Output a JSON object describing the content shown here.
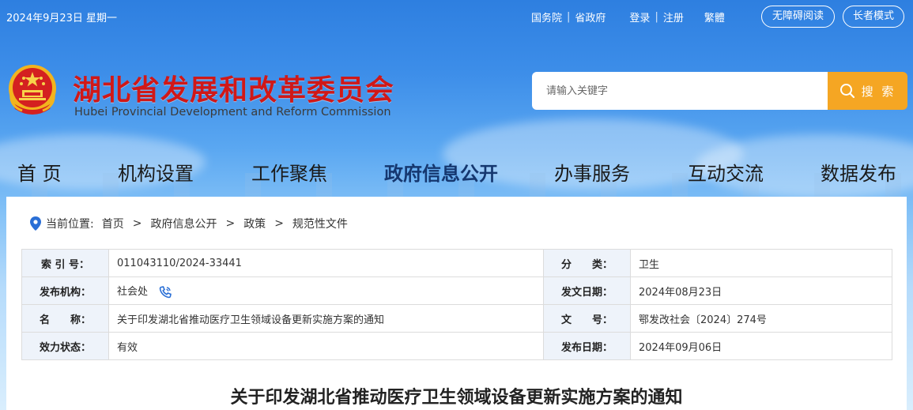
{
  "topbar": {
    "date": "2024年9月23日 星期一",
    "link_state_council": "国务院",
    "link_province": "省政府",
    "login": "登录",
    "register": "注册",
    "traditional": "繁體",
    "accessible": "无障碍阅读",
    "elder_mode": "长者模式"
  },
  "brand": {
    "title_cn": "湖北省发展和改革委员会",
    "title_en": "Hubei Provincial Development and Reform Commission"
  },
  "search": {
    "placeholder": "请输入关键字",
    "button_label": "搜 索"
  },
  "nav": {
    "items": [
      "首 页",
      "机构设置",
      "工作聚焦",
      "政府信息公开",
      "办事服务",
      "互动交流",
      "数据发布"
    ],
    "active": "政府信息公开"
  },
  "breadcrumb": {
    "prefix": "当前位置:",
    "items": [
      "首页",
      "政府信息公开",
      "政策",
      "规范性文件"
    ]
  },
  "info": {
    "index_label": "索 引 号：",
    "index_value": "011043110/2024-33441",
    "category_label": "分　　类：",
    "category_value": "卫生",
    "publisher_label": "发布机构：",
    "publisher_value": "社会处",
    "issue_date_label": "发文日期：",
    "issue_date_value": "2024年08月23日",
    "name_label": "名　　称：",
    "name_value": "关于印发湖北省推动医疗卫生领域设备更新实施方案的通知",
    "doc_no_label": "文　　号：",
    "doc_no_value": "鄂发改社会〔2024〕274号",
    "status_label": "效力状态：",
    "status_value": "有效",
    "publish_date_label": "发布日期：",
    "publish_date_value": "2024年09月06日"
  },
  "document": {
    "title": "关于印发湖北省推动医疗卫生领域设备更新实施方案的通知"
  },
  "colors": {
    "brand_red": "#d01818",
    "search_orange": "#f5a623",
    "nav_active": "#15376f",
    "sky_blue": "#3d8ee9"
  }
}
